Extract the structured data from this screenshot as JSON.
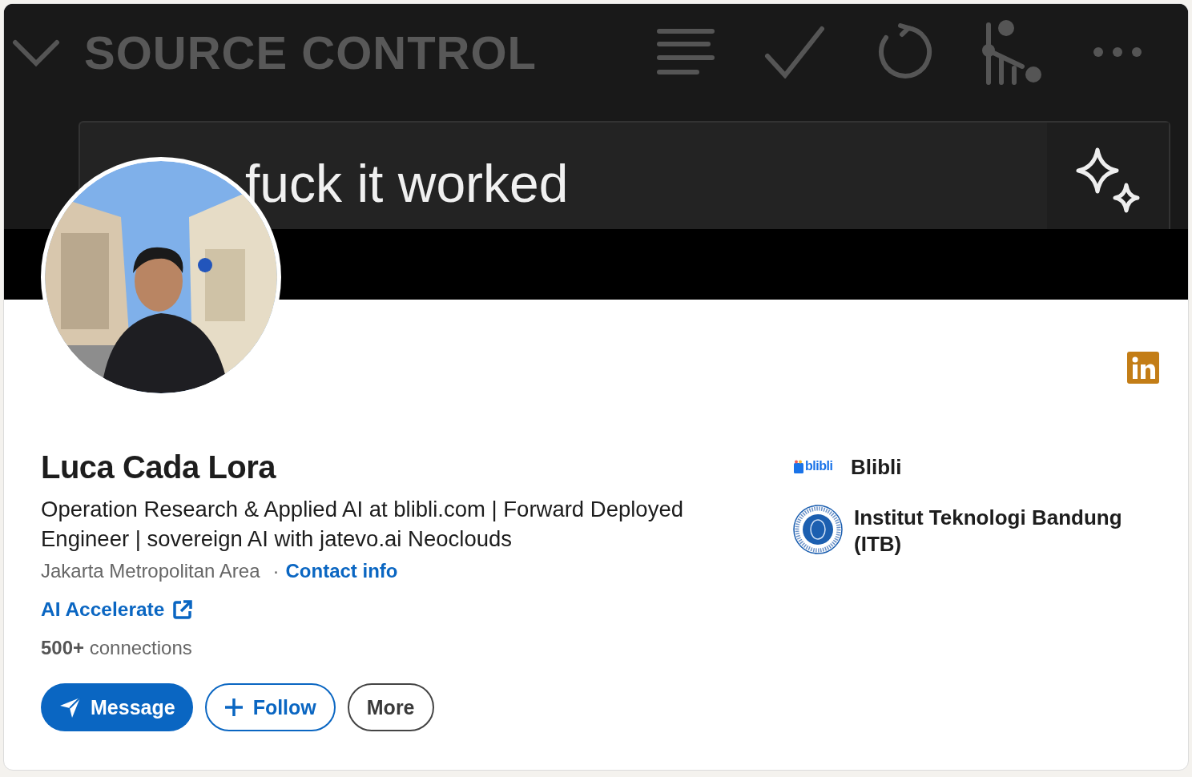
{
  "banner": {
    "panel_title": "SOURCE CONTROL",
    "message_value": "fuck it worked"
  },
  "profile": {
    "name": "Luca Cada Lora",
    "headline": "Operation Research & Applied AI at blibli.com | Forward Deployed Engineer | sovereign AI with jatevo.ai Neoclouds",
    "location": "Jakarta Metropolitan Area",
    "separator": "·",
    "contact_link": "Contact info",
    "website_link": "AI Accelerate",
    "connections": "**500+** connections"
  },
  "actions": [
    {
      "kind": "primary",
      "label": "Message"
    },
    {
      "kind": "follow",
      "label": "Follow"
    },
    {
      "kind": "plain",
      "label": "More"
    }
  ],
  "affiliations": [
    {
      "kind": "company",
      "name": "Blibli",
      "logo_text": "blibli"
    },
    {
      "kind": "school",
      "name": "Institut Teknologi Bandung (ITB)"
    }
  ]
}
